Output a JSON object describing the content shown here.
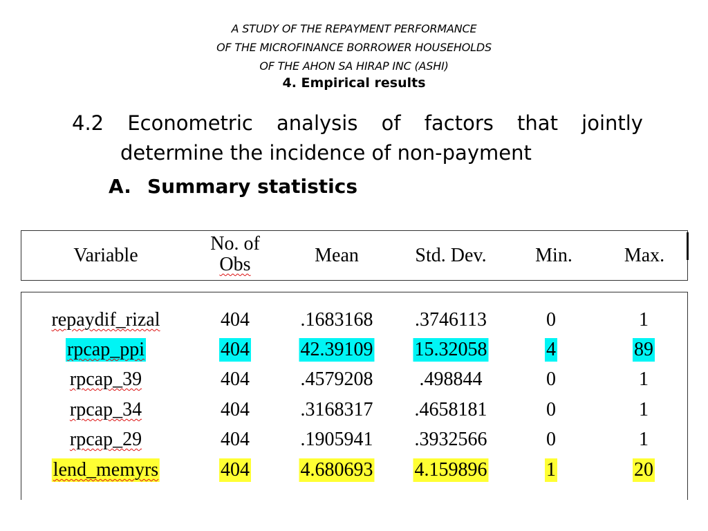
{
  "header": {
    "lines": [
      "A STUDY OF THE REPAYMENT PERFORMANCE",
      "OF THE MICROFINANCE BORROWER HOUSEHOLDS",
      "OF THE AHON SA HIRAP INC (ASHI)"
    ],
    "section": "4.  Empirical results"
  },
  "heading": {
    "words_line1": [
      "4.2",
      "Econometric",
      "analysis",
      "of",
      "factors",
      "that",
      "jointly"
    ],
    "line2": "determine the incidence of non-payment"
  },
  "subheading": {
    "letter": "A.",
    "text": "Summary statistics"
  },
  "table": {
    "columns": {
      "variable": "Variable",
      "obs_1": "No. of",
      "obs_2": "Obs",
      "mean": "Mean",
      "std": "Std. Dev.",
      "min": "Min.",
      "max": "Max."
    },
    "rows": [
      {
        "variable": "repaydif_rizal",
        "obs": "404",
        "mean": ".1683168",
        "std": ".3746113",
        "min": "0",
        "max": "1",
        "highlight": "none"
      },
      {
        "variable": "rpcap_ppi",
        "obs": "404",
        "mean": "42.39109",
        "std": "15.32058",
        "min": "4",
        "max": "89",
        "highlight": "cyan"
      },
      {
        "variable": "rpcap_39",
        "obs": "404",
        "mean": ".4579208",
        "std": ".498844",
        "min": "0",
        "max": "1",
        "highlight": "none"
      },
      {
        "variable": "rpcap_34",
        "obs": "404",
        "mean": ".3168317",
        "std": ".4658181",
        "min": "0",
        "max": "1",
        "highlight": "none"
      },
      {
        "variable": "rpcap_29",
        "obs": "404",
        "mean": ".1905941",
        "std": ".3932566",
        "min": "0",
        "max": "1",
        "highlight": "none"
      },
      {
        "variable": "lend_memyrs",
        "obs": "404",
        "mean": "4.680693",
        "std": "4.159896",
        "min": "1",
        "max": "20",
        "highlight": "yellow"
      }
    ]
  },
  "colors": {
    "cyan_highlight": "#00f5f5",
    "yellow_highlight": "#ffff33",
    "spellcheck_underline": "#d11"
  }
}
